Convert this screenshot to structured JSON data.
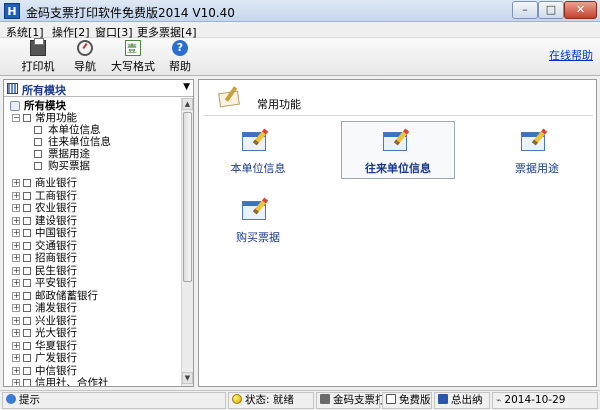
{
  "window": {
    "title": "金码支票打印软件免费版2014  V10.40",
    "app_icon_letter": "H",
    "minimize": "–",
    "maximize": "□",
    "close": "✕"
  },
  "menu": [
    "系统[1]",
    "操作[2]",
    "窗口[3]",
    "更多票据[4]"
  ],
  "toolbar": {
    "items": [
      {
        "label": "打印机",
        "icon": "printer-icon"
      },
      {
        "label": "导航",
        "icon": "navigation-icon"
      },
      {
        "label": "大写格式",
        "icon": "uppercase-format-icon"
      },
      {
        "label": "帮助",
        "icon": "help-icon"
      }
    ],
    "help_glyph": "?",
    "online_help": "在线帮助"
  },
  "left_panel": {
    "header": "所有模块",
    "dropdown_glyph": "▼",
    "tree": {
      "root": "所有模块",
      "common": {
        "label": "常用功能",
        "children": [
          "本单位信息",
          "往来单位信息",
          "票据用途",
          "购买票据"
        ]
      },
      "banks": [
        "商业银行",
        "工商银行",
        "农业银行",
        "建设银行",
        "中国银行",
        "交通银行",
        "招商银行",
        "民生银行",
        "平安银行",
        "邮政储蓄银行",
        "浦发银行",
        "兴业银行",
        "光大银行",
        "华夏银行",
        "广发银行",
        "中信银行",
        "信用社、合作社"
      ]
    },
    "expander_plus": "+",
    "expander_minus": "−",
    "scroll_up": "▲",
    "scroll_down": "▼"
  },
  "right_panel": {
    "section_title": "常用功能",
    "items": [
      "本单位信息",
      "往来单位信息",
      "票据用途",
      "购买票据"
    ],
    "selected_item": "往来单位信息"
  },
  "statusbar": {
    "hint": "提示",
    "status": "状态: 就绪",
    "product": "金码支票打印",
    "edition": "免费版",
    "total": "总出纳",
    "date": "2014-10-29",
    "date_glyph": "⌁"
  },
  "colors": {
    "accent": "#1a3a8a",
    "link": "#0033cc",
    "close_button": "#c4412c"
  }
}
